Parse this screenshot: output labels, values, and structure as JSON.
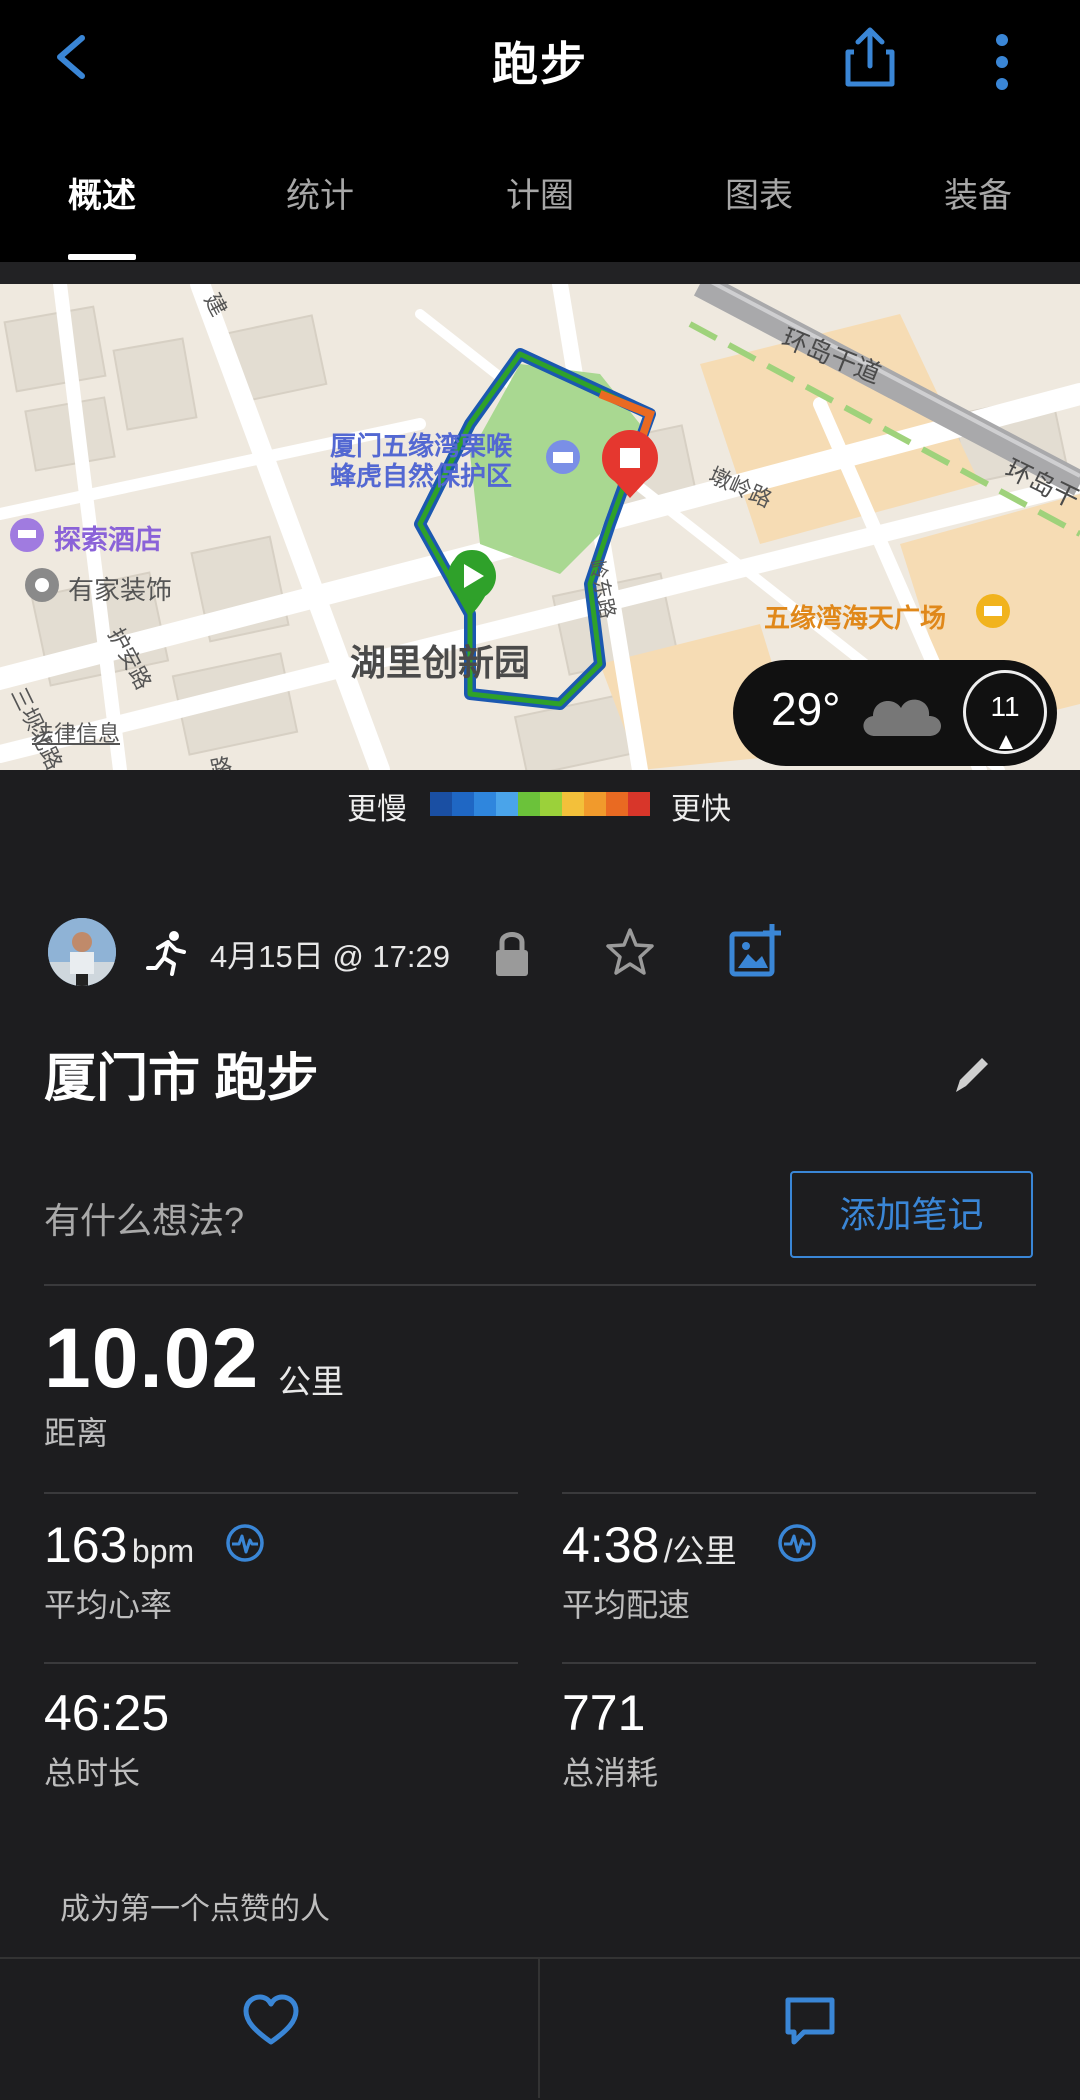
{
  "header": {
    "title": "跑步",
    "tabs": [
      {
        "label": "概述",
        "active": true
      },
      {
        "label": "统计",
        "active": false
      },
      {
        "label": "计圈",
        "active": false
      },
      {
        "label": "图表",
        "active": false
      },
      {
        "label": "装备",
        "active": false
      }
    ]
  },
  "map": {
    "labels": {
      "park": "厦门五缘湾栗喉",
      "park2": "蜂虎自然保护区",
      "hotel": "探索酒店",
      "deco": "有家装饰",
      "innovation": "湖里创新园",
      "plaza": "五缘湾海天广场",
      "ring_road": "环岛干道",
      "ring_road2": "环岛干",
      "dunling": "墩岭路",
      "huan": "护安路",
      "legal": "法律信息",
      "sanheng": "三坝北路",
      "jian": "建",
      "lu": "路",
      "ling": "岭东路"
    }
  },
  "weather": {
    "temperature": "29°",
    "wind": "11",
    "icon": "cloud-icon"
  },
  "legend": {
    "slower": "更慢",
    "faster": "更快",
    "colors": [
      "#1a4fa3",
      "#1f67c4",
      "#2f86dd",
      "#4aa4ea",
      "#6bc23a",
      "#9bd13a",
      "#f3c03a",
      "#f19a2c",
      "#e96a22",
      "#d8362a"
    ]
  },
  "activity": {
    "datetime": "4月15日 @ 17:29",
    "title": "厦门市 跑步",
    "thoughts_placeholder": "有什么想法?",
    "add_note": "添加笔记"
  },
  "stats": {
    "distance": {
      "value": "10.02",
      "unit": "公里",
      "label": "距离"
    },
    "avg_hr": {
      "value": "163",
      "unit": "bpm",
      "label": "平均心率"
    },
    "avg_pace": {
      "value": "4:38",
      "unit": "/公里",
      "label": "平均配速"
    },
    "duration": {
      "value": "46:25",
      "label": "总时长"
    },
    "calories": {
      "value": "771",
      "label": "总消耗"
    }
  },
  "social": {
    "likes_text": "成为第一个点赞的人"
  },
  "colors": {
    "accent": "#3a86d6",
    "background": "#1d1d1f",
    "route_start": "#2fa12a",
    "route_end": "#e5372f"
  }
}
